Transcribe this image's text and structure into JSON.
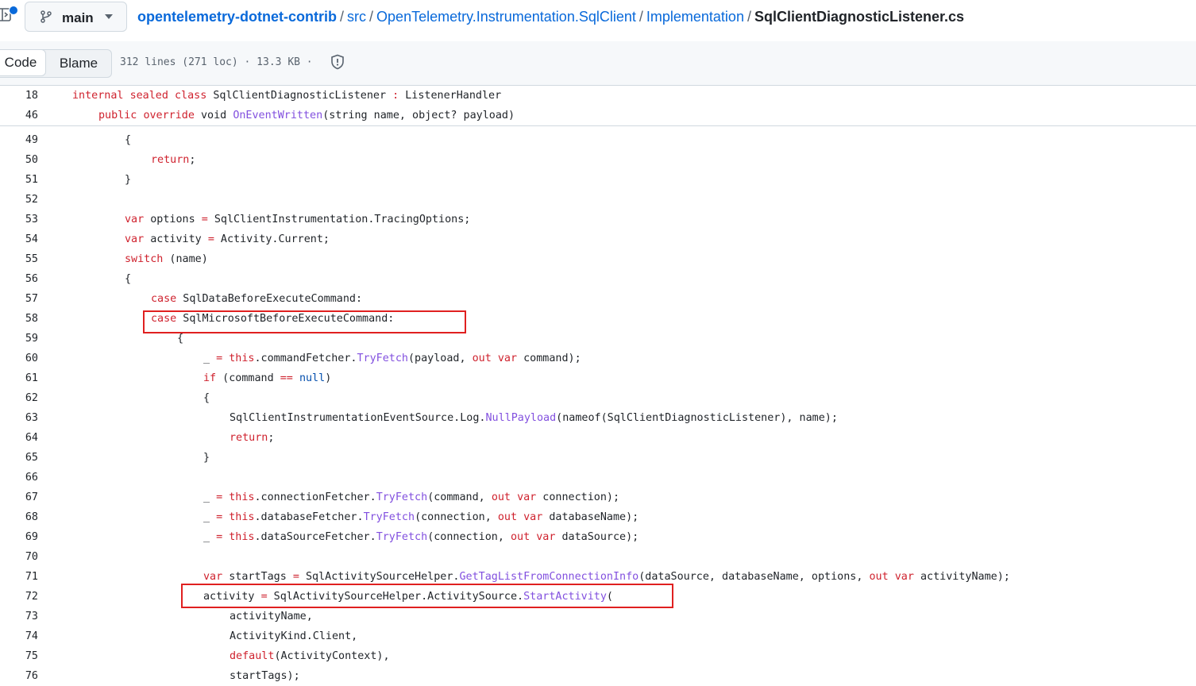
{
  "header": {
    "branch_label": "main",
    "breadcrumb": {
      "repo": "opentelemetry-dotnet-contrib",
      "parts": [
        "src",
        "OpenTelemetry.Instrumentation.SqlClient",
        "Implementation"
      ],
      "separator": "/",
      "file": "SqlClientDiagnosticListener.cs"
    }
  },
  "toolbar": {
    "code_tab": "Code",
    "blame_tab": "Blame",
    "file_meta": "312 lines (271 loc) · 13.3 KB ·"
  },
  "colors": {
    "keyword": "#cf222e",
    "function": "#8250df",
    "constant": "#0550ae",
    "link": "#0969da",
    "highlight_box": "#e02020"
  },
  "sticky_lines": [
    {
      "n": "18",
      "indent": 0,
      "tokens": [
        [
          "kw",
          "internal"
        ],
        [
          "t",
          " "
        ],
        [
          "kw",
          "sealed"
        ],
        [
          "t",
          " "
        ],
        [
          "kw",
          "class"
        ],
        [
          "t",
          " SqlClientDiagnosticListener "
        ],
        [
          "kw",
          ":"
        ],
        [
          "t",
          " ListenerHandler"
        ]
      ]
    },
    {
      "n": "46",
      "indent": 1,
      "tokens": [
        [
          "kw",
          "public"
        ],
        [
          "t",
          " "
        ],
        [
          "kw",
          "override"
        ],
        [
          "t",
          " void "
        ],
        [
          "fn",
          "OnEventWritten"
        ],
        [
          "t",
          "(string name, object? payload)"
        ]
      ]
    }
  ],
  "code_lines": [
    {
      "n": "49",
      "indent": 2,
      "tokens": [
        [
          "t",
          "{"
        ]
      ]
    },
    {
      "n": "50",
      "indent": 3,
      "tokens": [
        [
          "kw",
          "return"
        ],
        [
          "t",
          ";"
        ]
      ]
    },
    {
      "n": "51",
      "indent": 2,
      "tokens": [
        [
          "t",
          "}"
        ]
      ]
    },
    {
      "n": "52",
      "indent": 0,
      "tokens": []
    },
    {
      "n": "53",
      "indent": 2,
      "tokens": [
        [
          "kw",
          "var"
        ],
        [
          "t",
          " options "
        ],
        [
          "kw",
          "="
        ],
        [
          "t",
          " SqlClientInstrumentation.TracingOptions;"
        ]
      ]
    },
    {
      "n": "54",
      "indent": 2,
      "tokens": [
        [
          "kw",
          "var"
        ],
        [
          "t",
          " activity "
        ],
        [
          "kw",
          "="
        ],
        [
          "t",
          " Activity.Current;"
        ]
      ]
    },
    {
      "n": "55",
      "indent": 2,
      "tokens": [
        [
          "kw",
          "switch"
        ],
        [
          "t",
          " (name)"
        ]
      ]
    },
    {
      "n": "56",
      "indent": 2,
      "tokens": [
        [
          "t",
          "{"
        ]
      ]
    },
    {
      "n": "57",
      "indent": 3,
      "tokens": [
        [
          "kw",
          "case"
        ],
        [
          "t",
          " SqlDataBeforeExecuteCommand:"
        ]
      ]
    },
    {
      "n": "58",
      "indent": 3,
      "tokens": [
        [
          "kw",
          "case"
        ],
        [
          "t",
          " SqlMicrosoftBeforeExecuteCommand:"
        ]
      ]
    },
    {
      "n": "59",
      "indent": 4,
      "tokens": [
        [
          "t",
          "{"
        ]
      ]
    },
    {
      "n": "60",
      "indent": 5,
      "tokens": [
        [
          "t",
          "_ "
        ],
        [
          "kw",
          "="
        ],
        [
          "t",
          " "
        ],
        [
          "kw",
          "this"
        ],
        [
          "t",
          ".commandFetcher."
        ],
        [
          "fn",
          "TryFetch"
        ],
        [
          "t",
          "(payload, "
        ],
        [
          "kw",
          "out"
        ],
        [
          "t",
          " "
        ],
        [
          "kw",
          "var"
        ],
        [
          "t",
          " command);"
        ]
      ]
    },
    {
      "n": "61",
      "indent": 5,
      "tokens": [
        [
          "kw",
          "if"
        ],
        [
          "t",
          " (command "
        ],
        [
          "kw",
          "=="
        ],
        [
          "t",
          " "
        ],
        [
          "num",
          "null"
        ],
        [
          "t",
          ")"
        ]
      ]
    },
    {
      "n": "62",
      "indent": 5,
      "tokens": [
        [
          "t",
          "{"
        ]
      ]
    },
    {
      "n": "63",
      "indent": 6,
      "tokens": [
        [
          "t",
          "SqlClientInstrumentationEventSource.Log."
        ],
        [
          "fn",
          "NullPayload"
        ],
        [
          "t",
          "(nameof(SqlClientDiagnosticListener), name);"
        ]
      ]
    },
    {
      "n": "64",
      "indent": 6,
      "tokens": [
        [
          "kw",
          "return"
        ],
        [
          "t",
          ";"
        ]
      ]
    },
    {
      "n": "65",
      "indent": 5,
      "tokens": [
        [
          "t",
          "}"
        ]
      ]
    },
    {
      "n": "66",
      "indent": 0,
      "tokens": []
    },
    {
      "n": "67",
      "indent": 5,
      "tokens": [
        [
          "t",
          "_ "
        ],
        [
          "kw",
          "="
        ],
        [
          "t",
          " "
        ],
        [
          "kw",
          "this"
        ],
        [
          "t",
          ".connectionFetcher."
        ],
        [
          "fn",
          "TryFetch"
        ],
        [
          "t",
          "(command, "
        ],
        [
          "kw",
          "out"
        ],
        [
          "t",
          " "
        ],
        [
          "kw",
          "var"
        ],
        [
          "t",
          " connection);"
        ]
      ]
    },
    {
      "n": "68",
      "indent": 5,
      "tokens": [
        [
          "t",
          "_ "
        ],
        [
          "kw",
          "="
        ],
        [
          "t",
          " "
        ],
        [
          "kw",
          "this"
        ],
        [
          "t",
          ".databaseFetcher."
        ],
        [
          "fn",
          "TryFetch"
        ],
        [
          "t",
          "(connection, "
        ],
        [
          "kw",
          "out"
        ],
        [
          "t",
          " "
        ],
        [
          "kw",
          "var"
        ],
        [
          "t",
          " databaseName);"
        ]
      ]
    },
    {
      "n": "69",
      "indent": 5,
      "tokens": [
        [
          "t",
          "_ "
        ],
        [
          "kw",
          "="
        ],
        [
          "t",
          " "
        ],
        [
          "kw",
          "this"
        ],
        [
          "t",
          ".dataSourceFetcher."
        ],
        [
          "fn",
          "TryFetch"
        ],
        [
          "t",
          "(connection, "
        ],
        [
          "kw",
          "out"
        ],
        [
          "t",
          " "
        ],
        [
          "kw",
          "var"
        ],
        [
          "t",
          " dataSource);"
        ]
      ]
    },
    {
      "n": "70",
      "indent": 0,
      "tokens": []
    },
    {
      "n": "71",
      "indent": 5,
      "tokens": [
        [
          "kw",
          "var"
        ],
        [
          "t",
          " startTags "
        ],
        [
          "kw",
          "="
        ],
        [
          "t",
          " SqlActivitySourceHelper."
        ],
        [
          "fn",
          "GetTagListFromConnectionInfo"
        ],
        [
          "t",
          "(dataSource, databaseName, options, "
        ],
        [
          "kw",
          "out"
        ],
        [
          "t",
          " "
        ],
        [
          "kw",
          "var"
        ],
        [
          "t",
          " activityName);"
        ]
      ]
    },
    {
      "n": "72",
      "indent": 5,
      "tokens": [
        [
          "t",
          "activity "
        ],
        [
          "kw",
          "="
        ],
        [
          "t",
          " SqlActivitySourceHelper.ActivitySource."
        ],
        [
          "fn",
          "StartActivity"
        ],
        [
          "t",
          "("
        ]
      ]
    },
    {
      "n": "73",
      "indent": 6,
      "tokens": [
        [
          "t",
          "activityName,"
        ]
      ]
    },
    {
      "n": "74",
      "indent": 6,
      "tokens": [
        [
          "t",
          "ActivityKind.Client,"
        ]
      ]
    },
    {
      "n": "75",
      "indent": 6,
      "tokens": [
        [
          "kw",
          "default"
        ],
        [
          "t",
          "(ActivityContext),"
        ]
      ]
    },
    {
      "n": "76",
      "indent": 6,
      "tokens": [
        [
          "t",
          "startTags);"
        ]
      ]
    }
  ]
}
